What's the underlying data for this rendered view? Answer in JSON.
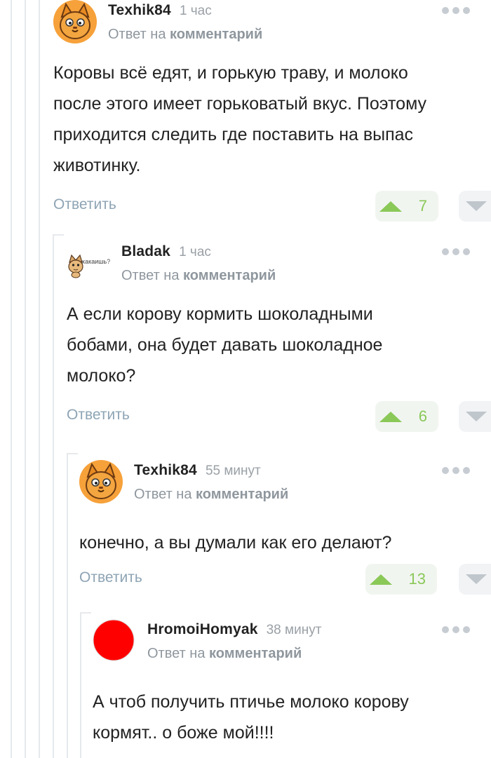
{
  "ui": {
    "reply_prefix": "Ответ на",
    "reply_link": "комментарий",
    "reply_button": "Ответить"
  },
  "colors": {
    "upvote": "#8ac858",
    "link": "#8ea4b4",
    "muted": "#8f979e",
    "thread_line": "#e6e9ec",
    "avatar_red": "#ff0000"
  },
  "comments": [
    {
      "author": "Texhik84",
      "time": "1 час",
      "avatar": "orange-cat-avatar",
      "text_lines": [
        "Коровы всё едят, и горькую траву, и молоко",
        "после этого имеет горьковатый вкус. Поэтому",
        "приходится следить где поставить на выпас",
        "животинку."
      ],
      "rating": "7"
    },
    {
      "author": "Bladak",
      "time": "1 час",
      "avatar": "cat-sticker-avatar",
      "avatar_caption": "какаишь?",
      "text_lines": [
        "А если корову кормить шоколадными",
        "бобами, она будет давать шоколадное",
        "молоко?"
      ],
      "rating": "6"
    },
    {
      "author": "Texhik84",
      "time": "55 минут",
      "avatar": "orange-cat-avatar",
      "text_lines": [
        "конечно, а вы думали как его делают?"
      ],
      "rating": "13"
    },
    {
      "author": "HromoiHomyak",
      "time": "38 минут",
      "avatar": "red-circle-avatar",
      "text_lines": [
        "А чтоб получить птичье молоко корову",
        "кормят.. о боже мой!!!!"
      ]
    }
  ]
}
